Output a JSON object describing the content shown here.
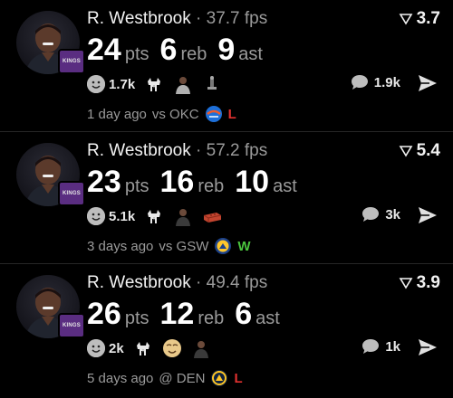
{
  "posts": [
    {
      "player": "R. Westbrook",
      "separator": "·",
      "fps": "37.7 fps",
      "rating": "3.7",
      "stats": [
        {
          "value": "24",
          "unit": "pts"
        },
        {
          "value": "6",
          "unit": "reb"
        },
        {
          "value": "9",
          "unit": "ast"
        }
      ],
      "reaction_count": "1.7k",
      "reaction_emojis": [
        "goat-icon",
        "player-emoji-icon",
        "trophy-photo-icon"
      ],
      "comment_count": "1.9k",
      "time_ago": "1 day ago",
      "matchup": "vs OKC",
      "opponent_logo": "okc-logo-icon",
      "result": "L",
      "result_color": "#e0312f"
    },
    {
      "player": "R. Westbrook",
      "separator": "·",
      "fps": "57.2 fps",
      "rating": "5.4",
      "stats": [
        {
          "value": "23",
          "unit": "pts"
        },
        {
          "value": "16",
          "unit": "reb"
        },
        {
          "value": "10",
          "unit": "ast"
        }
      ],
      "reaction_count": "5.1k",
      "reaction_emojis": [
        "goat-icon",
        "player-emoji-icon",
        "brick-icon"
      ],
      "comment_count": "3k",
      "time_ago": "3 days ago",
      "matchup": "vs GSW",
      "opponent_logo": "gsw-logo-icon",
      "result": "W",
      "result_color": "#4bc43e"
    },
    {
      "player": "R. Westbrook",
      "separator": "·",
      "fps": "49.4 fps",
      "rating": "3.9",
      "stats": [
        {
          "value": "26",
          "unit": "pts"
        },
        {
          "value": "12",
          "unit": "reb"
        },
        {
          "value": "6",
          "unit": "ast"
        }
      ],
      "reaction_count": "2k",
      "reaction_emojis": [
        "goat-icon",
        "smiling-face-icon",
        "player-emoji-icon"
      ],
      "comment_count": "1k",
      "time_ago": "5 days ago",
      "matchup": "@ DEN",
      "opponent_logo": "den-logo-icon",
      "result": "L",
      "result_color": "#e0312f"
    }
  ],
  "team_badge_text": "KINGS",
  "colors": {
    "background": "#000000",
    "win": "#4bc43e",
    "loss": "#e0312f",
    "kings_purple": "#5a2d81"
  }
}
